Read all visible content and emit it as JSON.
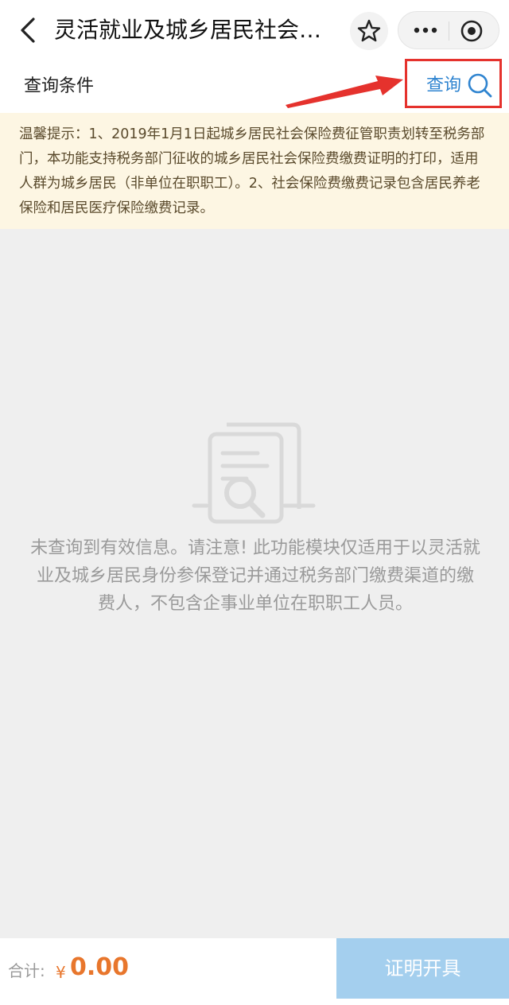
{
  "nav": {
    "title": "灵活就业及城乡居民社会保…",
    "icons": [
      "back-icon",
      "star-icon",
      "more-icon",
      "target-icon"
    ]
  },
  "query_bar": {
    "label": "查询条件",
    "query_button": "查询"
  },
  "notice": {
    "text": "温馨提示：1、2019年1月1日起城乡居民社会保险费征管职责划转至税务部门，本功能支持税务部门征收的城乡居民社会保险费缴费证明的打印，适用人群为城乡居民（非单位在职职工）。2、社会保险费缴费记录包含居民养老保险和居民医疗保险缴费记录。"
  },
  "empty_state": {
    "message": "未查询到有效信息。请注意! 此功能模块仅适用于以灵活就业及城乡居民身份参保登记并通过税务部门缴费渠道的缴费人，不包含企事业单位在职职工人员。"
  },
  "footer": {
    "total_label": "合计:",
    "currency": "¥",
    "amount": "0.00",
    "issue_button": "证明开具"
  },
  "colors": {
    "accent_blue": "#2f84d0",
    "highlight_red": "#e5322d",
    "amount_orange": "#e8762c",
    "button_disabled_blue": "#a4cfee",
    "notice_bg": "#fdf6e3"
  }
}
